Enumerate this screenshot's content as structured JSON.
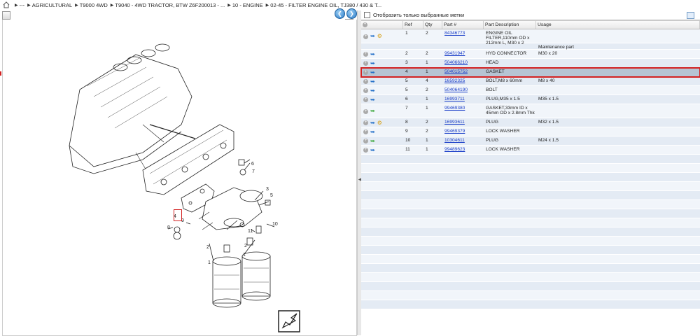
{
  "breadcrumb": {
    "items": [
      "---",
      "AGRICULTURAL",
      "T9000 4WD",
      "T9040 - 4WD TRACTOR, BTW Z6F200013 - ...",
      "10 - ENGINE",
      "02-45 - FILTER ENGINE OIL, TJ380 / 430 & T..."
    ]
  },
  "filter": {
    "label": "Отобразить только выбранные метки"
  },
  "table": {
    "headers": {
      "ref": "Ref",
      "qty": "Qty",
      "part": "Part #",
      "desc": "Part Description",
      "usage": "Usage"
    },
    "rows": [
      {
        "ref": "1",
        "qty": "2",
        "part": "84346773",
        "desc": "ENGINE OIL FILTER,110mm OD x 212mm L, M30 x 2",
        "usage": "",
        "icons": [
          "plus",
          "blue",
          "gear"
        ]
      },
      {
        "ref": "",
        "qty": "",
        "part": "",
        "desc": "",
        "usage": "Maintenance part",
        "icons": []
      },
      {
        "ref": "2",
        "qty": "2",
        "part": "99431947",
        "desc": "HYD CONNECTOR",
        "usage": "M30 x 20",
        "icons": [
          "plus",
          "blue"
        ]
      },
      {
        "ref": "3",
        "qty": "1",
        "part": "504066210",
        "desc": "HEAD",
        "usage": "",
        "icons": [
          "plus",
          "blue"
        ]
      },
      {
        "ref": "4",
        "qty": "1",
        "part": "504015752",
        "desc": "GASKET",
        "usage": "",
        "icons": [
          "plus",
          "blue"
        ],
        "selected": true
      },
      {
        "ref": "5",
        "qty": "4",
        "part": "16592325",
        "desc": "BOLT,M8 x 60mm",
        "usage": "M8 x 40",
        "icons": [
          "plus",
          "blue"
        ]
      },
      {
        "ref": "5",
        "qty": "2",
        "part": "504064190",
        "desc": "BOLT",
        "usage": "",
        "icons": [
          "plus",
          "blue"
        ]
      },
      {
        "ref": "6",
        "qty": "1",
        "part": "16993711",
        "desc": "PLUG,M35 x 1.5",
        "usage": "M35 x 1.5",
        "icons": [
          "plus",
          "blue"
        ]
      },
      {
        "ref": "7",
        "qty": "1",
        "part": "99469380",
        "desc": "GASKET,33mm ID x 45mm OD x 2.8mm Thk",
        "usage": "",
        "icons": [
          "plus",
          "green"
        ]
      },
      {
        "ref": "8",
        "qty": "2",
        "part": "16993611",
        "desc": "PLUG",
        "usage": "M32 x 1.5",
        "icons": [
          "plus",
          "blue",
          "gear"
        ]
      },
      {
        "ref": "9",
        "qty": "2",
        "part": "99469379",
        "desc": "LOCK WASHER",
        "usage": "",
        "icons": [
          "plus",
          "blue"
        ]
      },
      {
        "ref": "10",
        "qty": "1",
        "part": "10304611",
        "desc": "PLUG",
        "usage": "M24 x 1.5",
        "icons": [
          "plus",
          "green"
        ]
      },
      {
        "ref": "11",
        "qty": "1",
        "part": "99489623",
        "desc": "LOCK WASHER",
        "usage": "",
        "icons": [
          "plus",
          "blue"
        ]
      }
    ]
  },
  "drawing": {
    "callouts": [
      "1",
      "1",
      "2",
      "2",
      "3",
      "4",
      "5",
      "6",
      "7",
      "8",
      "9",
      "10",
      "11"
    ]
  },
  "colors": {
    "accent_red": "#d32222",
    "link_blue": "#1a3ec8",
    "row_selected": "#b6c4d3"
  }
}
